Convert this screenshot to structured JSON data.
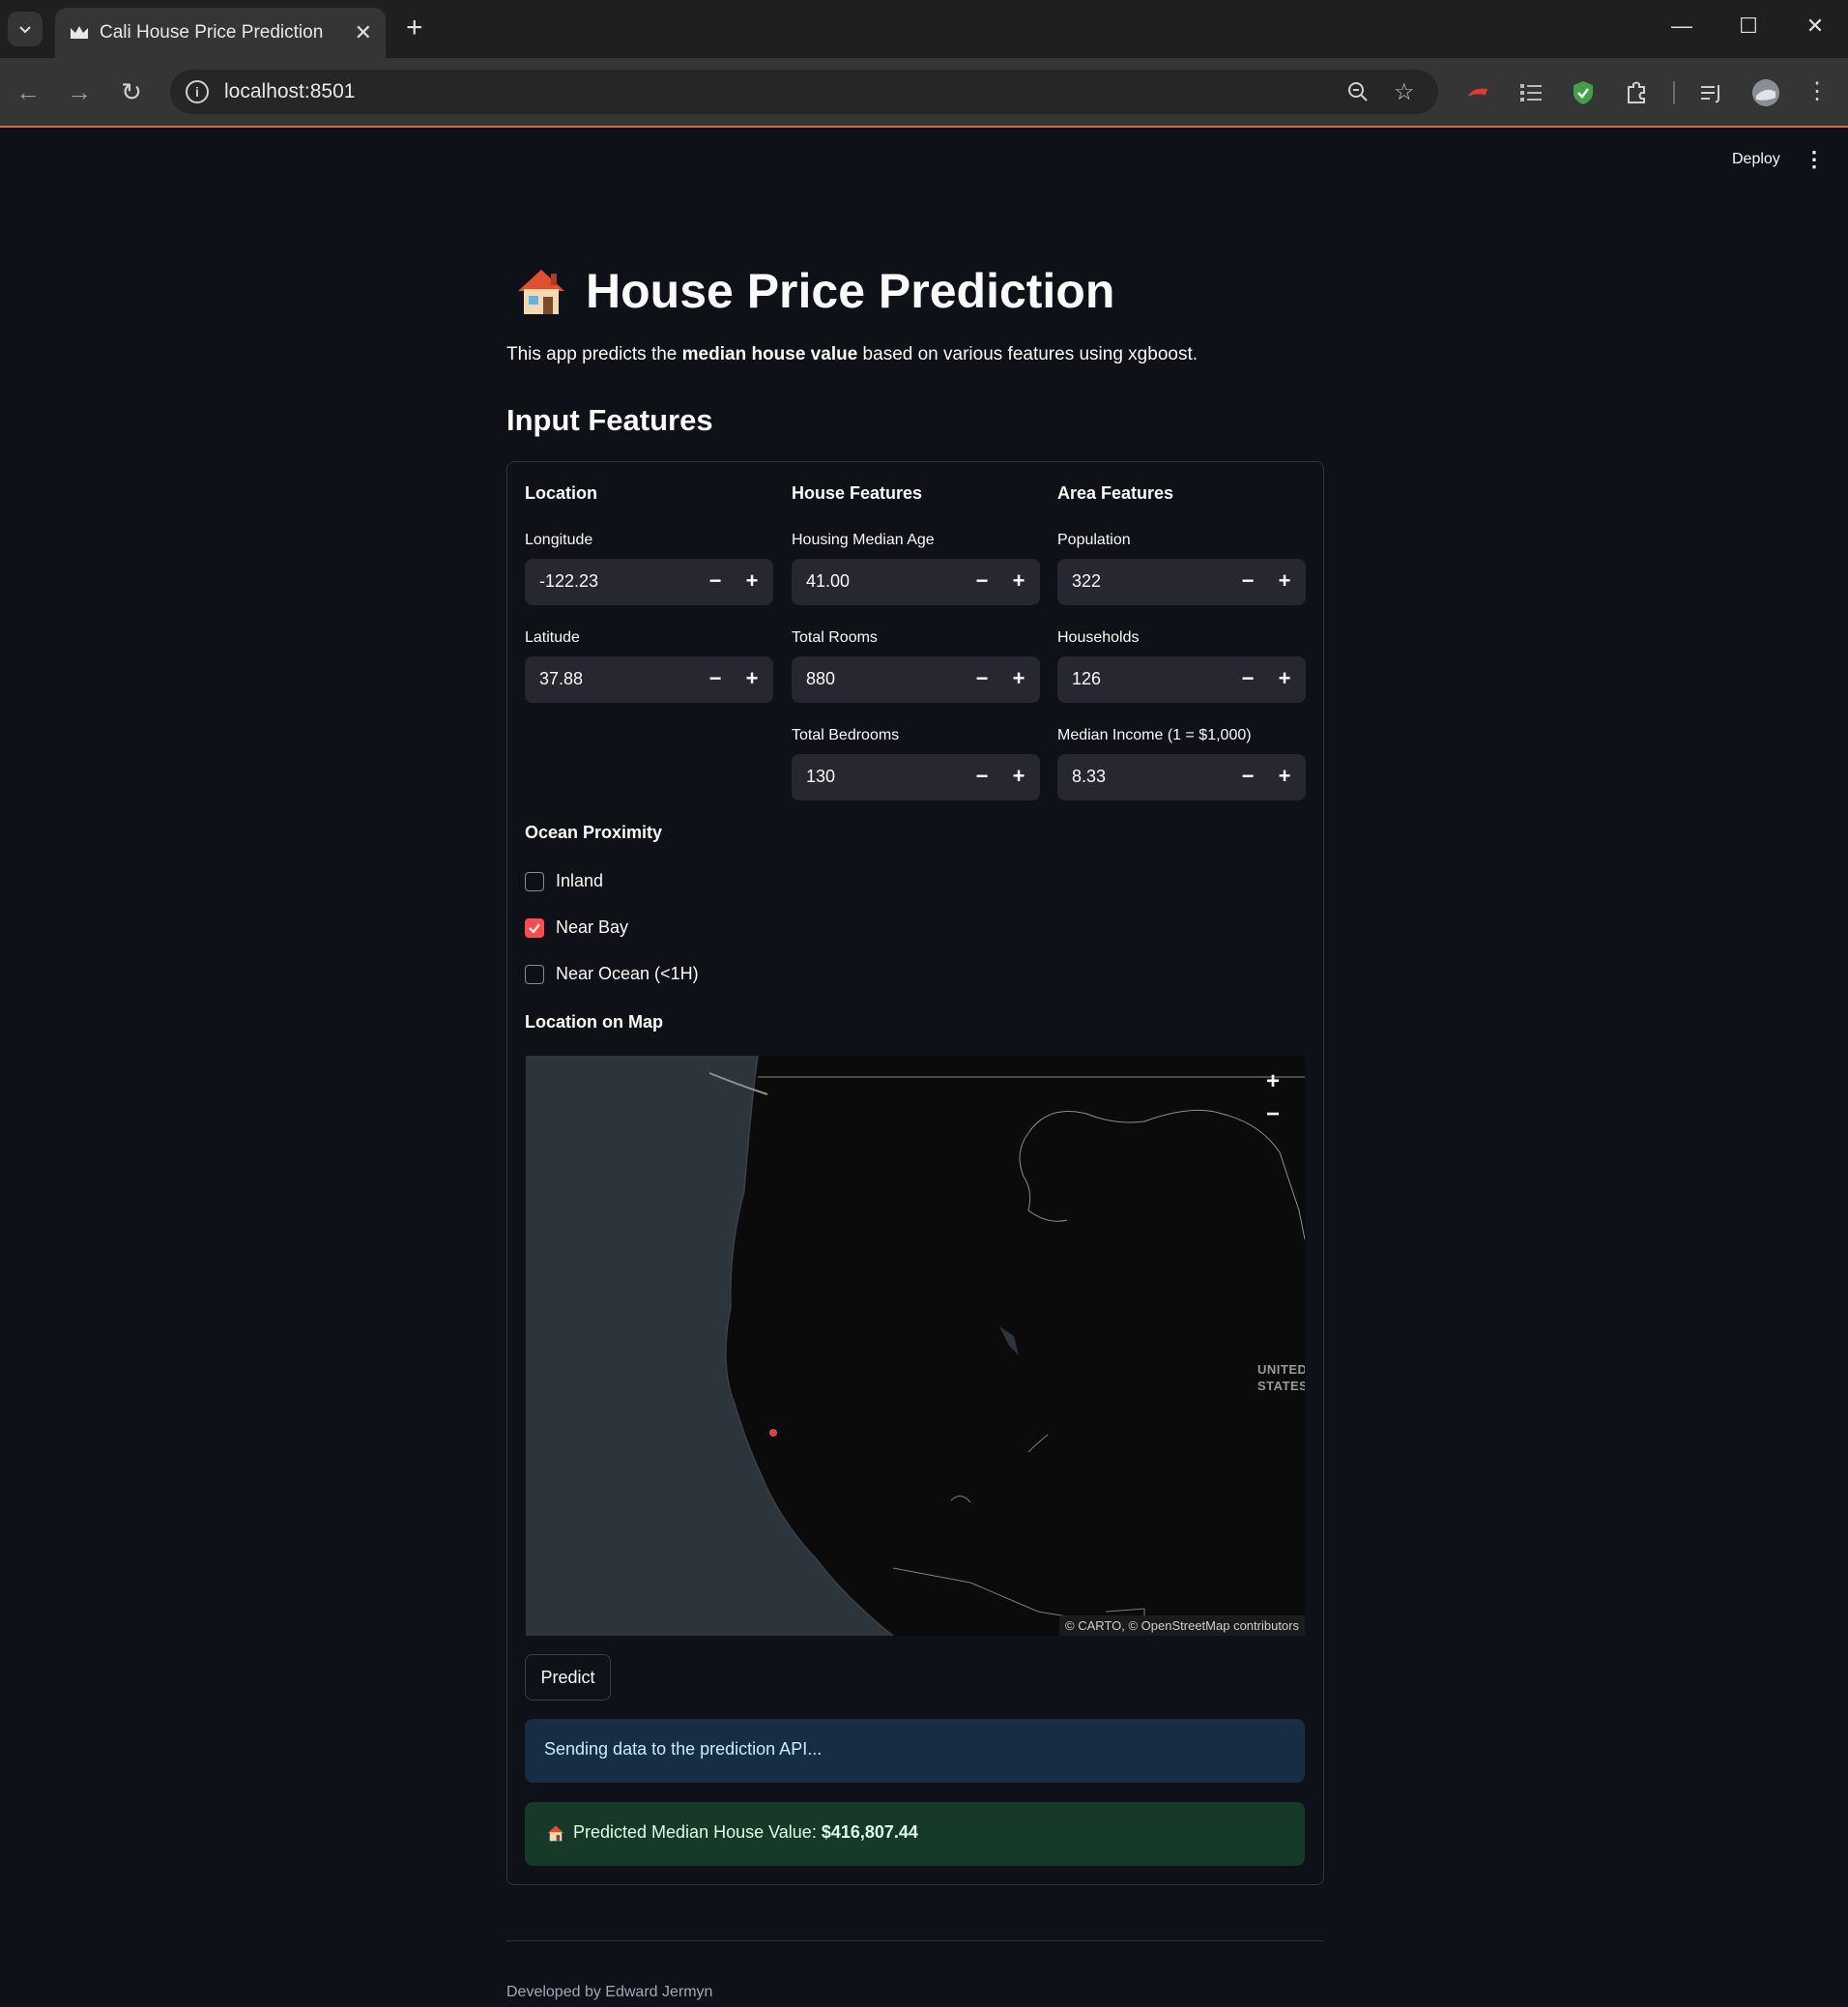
{
  "browser": {
    "tab_title": "Cali House Price Prediction",
    "url": "localhost:8501"
  },
  "header": {
    "deploy_label": "Deploy"
  },
  "app": {
    "title": "House Price Prediction",
    "subtitle_pre": "This app predicts the ",
    "subtitle_bold": "median house value",
    "subtitle_post": " based on various features using xgboost.",
    "section_heading": "Input Features"
  },
  "columns": [
    {
      "heading": "Location",
      "fields": [
        {
          "label": "Longitude",
          "value": "-122.23"
        },
        {
          "label": "Latitude",
          "value": "37.88"
        }
      ]
    },
    {
      "heading": "House Features",
      "fields": [
        {
          "label": "Housing Median Age",
          "value": "41.00"
        },
        {
          "label": "Total Rooms",
          "value": "880"
        },
        {
          "label": "Total Bedrooms",
          "value": "130"
        }
      ]
    },
    {
      "heading": "Area Features",
      "fields": [
        {
          "label": "Population",
          "value": "322"
        },
        {
          "label": "Households",
          "value": "126"
        },
        {
          "label": "Median Income (1 = $1,000)",
          "value": "8.33"
        }
      ]
    }
  ],
  "ocean_proximity": {
    "heading": "Ocean Proximity",
    "options": [
      {
        "label": "Inland",
        "checked": false
      },
      {
        "label": "Near Bay",
        "checked": true
      },
      {
        "label": "Near Ocean (<1H)",
        "checked": false
      }
    ]
  },
  "map": {
    "heading": "Location on Map",
    "country_label_1": "UNITED",
    "country_label_2": "STATES",
    "attribution": "© CARTO, © OpenStreetMap contributors"
  },
  "predict_label": "Predict",
  "info_message": "Sending data to the prediction API...",
  "result": {
    "label": "Predicted Median House Value: ",
    "value": "$416,807.44"
  },
  "footer": "Developed by Edward Jermyn",
  "colors": {
    "background": "#0e1117",
    "accent": "#ff4b4b",
    "info_bg": "#172d43",
    "success_bg": "#173928"
  }
}
